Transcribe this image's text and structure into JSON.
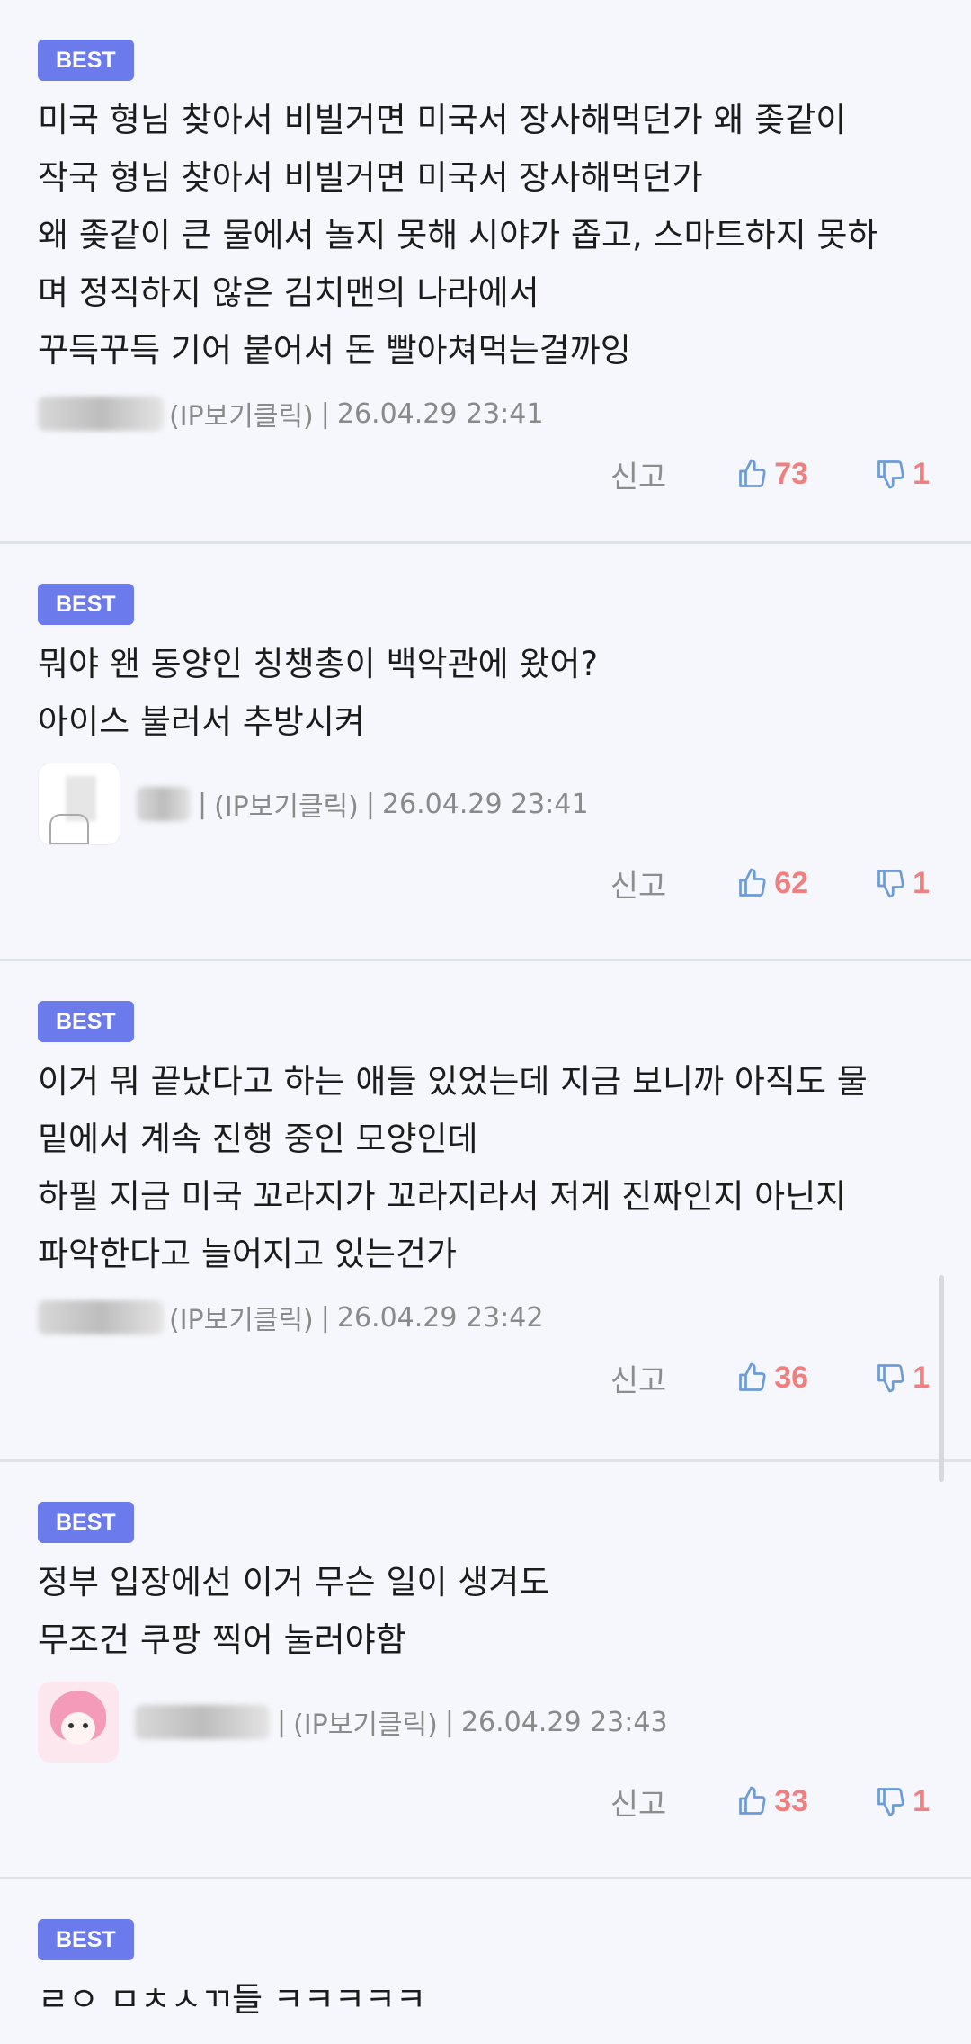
{
  "comments": [
    {
      "badge": "BEST",
      "lines": [
        "미국 형님 찾아서 비빌거면 미국서 장사해먹던가 왜 좆같이",
        "작국 형님 찾아서 비빌거면 미국서 장사해먹던가",
        "왜 좆같이 큰 물에서 놀지 못해 시야가 좁고, 스마트하지 못하",
        "며 정직하지 않은 김치맨의 나라에서",
        "꾸득꾸득 기어 붙어서 돈 빨아쳐먹는걸까잉"
      ],
      "ip": "(IP보기클릭)",
      "sep": "|",
      "datetime": "26.04.29 23:41",
      "report": "신고",
      "likes": "73",
      "dislikes": "1"
    },
    {
      "badge": "BEST",
      "lines": [
        "뭐야 왠 동양인 칭챙총이 백악관에 왔어?",
        "아이스 불러서 추방시켜"
      ],
      "ip": "(IP보기클릭)",
      "sep": "|",
      "datetime": "26.04.29 23:41",
      "report": "신고",
      "likes": "62",
      "dislikes": "1"
    },
    {
      "badge": "BEST",
      "lines": [
        "이거 뭐 끝났다고 하는 애들 있었는데 지금 보니까 아직도 물",
        "밑에서 계속 진행 중인 모양인데",
        "하필 지금 미국 꼬라지가 꼬라지라서 저게 진짜인지 아닌지",
        "파악한다고 늘어지고 있는건가"
      ],
      "ip": "(IP보기클릭)",
      "sep": "|",
      "datetime": "26.04.29 23:42",
      "report": "신고",
      "likes": "36",
      "dislikes": "1"
    },
    {
      "badge": "BEST",
      "lines": [
        "정부 입장에선 이거 무슨 일이 생겨도",
        "무조건 쿠팡 찍어 눌러야함"
      ],
      "ip": "(IP보기클릭)",
      "sep": "|",
      "datetime": "26.04.29 23:43",
      "report": "신고",
      "likes": "33",
      "dislikes": "1"
    },
    {
      "badge": "BEST",
      "lines": [
        "ㄹㅇ ㅁㅊㅅㄲ들 ㅋㅋㅋㅋㅋ"
      ]
    }
  ],
  "icons": {
    "like": "thumbs-up-icon",
    "dislike": "thumbs-down-icon"
  },
  "colors": {
    "badge": "#6c7bec",
    "count": "#f08080",
    "thumb": "#6b9bd8",
    "background": "#f5f7fc"
  }
}
